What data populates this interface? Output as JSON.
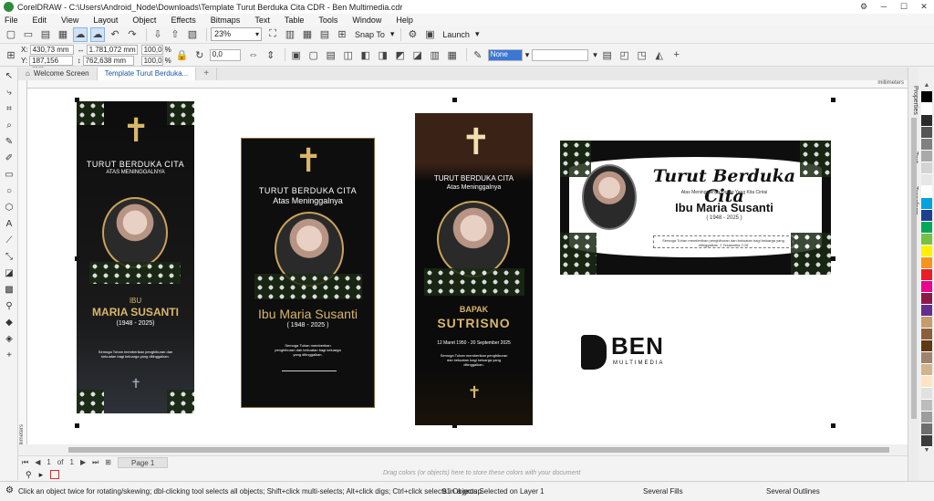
{
  "window": {
    "title": "CorelDRAW - C:\\Users\\Android_Node\\Downloads\\Template Turut Berduka Cita CDR - Ben Multimedia.cdr"
  },
  "menu": [
    "File",
    "Edit",
    "View",
    "Layout",
    "Object",
    "Effects",
    "Bitmaps",
    "Text",
    "Table",
    "Tools",
    "Window",
    "Help"
  ],
  "toolbar": {
    "zoom": "23%",
    "snap": "Snap To",
    "launch": "Launch"
  },
  "props": {
    "x": "430,73 mm",
    "y": "187,156 mm",
    "w": "1.781,072 mm",
    "h": "762,638 mm",
    "sx": "100,0",
    "sy": "100,0",
    "unit": "%",
    "rotation": "0,0",
    "outline": "None"
  },
  "tabs": {
    "welcome": "Welcome Screen",
    "doc": "Template Turut Berduka..."
  },
  "ruler": {
    "unit": "millimeters"
  },
  "pages": {
    "page_of": "1",
    "of_label": "of",
    "total": "1",
    "page_tab": "Page 1"
  },
  "colorbar": {
    "hint": "Drag colors (or objects) here to store these colors with your document"
  },
  "status": {
    "tip": "Click an object twice for rotating/skewing; dbl-clicking tool selects all objects; Shift+click multi-selects; Alt+click digs; Ctrl+click selects in a group",
    "selection": "91 Objects Selected on Layer 1",
    "fills": "Several Fills",
    "outlines": "Several Outlines"
  },
  "rightpanel": {
    "properties": "Properties",
    "text": "Text",
    "transform": "Transform"
  },
  "palette": [
    "#000000",
    "#ffffff",
    "#2b2b2b",
    "#555555",
    "#808080",
    "#aaaaaa",
    "#d4d4d4",
    "#e6e6e6",
    "#ffffff",
    "#00a3e0",
    "#1e3f8f",
    "#00a85a",
    "#76c043",
    "#fff200",
    "#f7941d",
    "#ed1c24",
    "#ec008c",
    "#8b1a4a",
    "#662d91",
    "#c69c6d",
    "#8b5e3c",
    "#603913",
    "#a0826d",
    "#d2b48c",
    "#ffe4c4",
    "#e1e1e1",
    "#bcbcbc",
    "#9d9d9d",
    "#6e6e6e",
    "#3c3c3c"
  ],
  "cards": {
    "c1": {
      "line1": "TURUT BERDUKA CITA",
      "line2": "ATAS MENINGGALNYA",
      "prefix": "IBU",
      "name": "MARIA SUSANTI",
      "dates": "(1948 - 2025)",
      "verse": "Semoga Tuhan memberikan penghiburan dan kekuatan bagi keluarga yang ditinggalkan."
    },
    "c2": {
      "line1": "TURUT BERDUKA CITA",
      "line2": "Atas Meninggalnya",
      "name": "Ibu Maria Susanti",
      "dates": "( 1948 - 2025 )",
      "verse": "Semoga Tuhan memberikan penghiburan dan kekuatan bagi keluarga yang ditinggalkan."
    },
    "c3": {
      "line1": "TURUT BERDUKA CITA",
      "line2": "Atas Meninggalnya",
      "prefix": "BAPAK",
      "name": "SUTRISNO",
      "dates": "12 Maret 1950 - 20 September 2025",
      "verse": "Semoga Tuhan memberikan penghiburan dan kekuatan bagi keluarga yang ditinggalkan."
    },
    "c4": {
      "title": "Turut Berduka Cita",
      "line2": "Atas Meninggalnya Orang Yang Kita Cintai",
      "name": "Ibu Maria Susanti",
      "dates": "( 1948 - 2025 )",
      "verse": "Semoga Tuhan memberikan penghiburan dan kekuatan bagi keluarga yang ditinggalkan. 2 Tesalonika 2:16"
    }
  },
  "logo": {
    "name": "BEN",
    "sub": "MULTIMEDIA"
  }
}
